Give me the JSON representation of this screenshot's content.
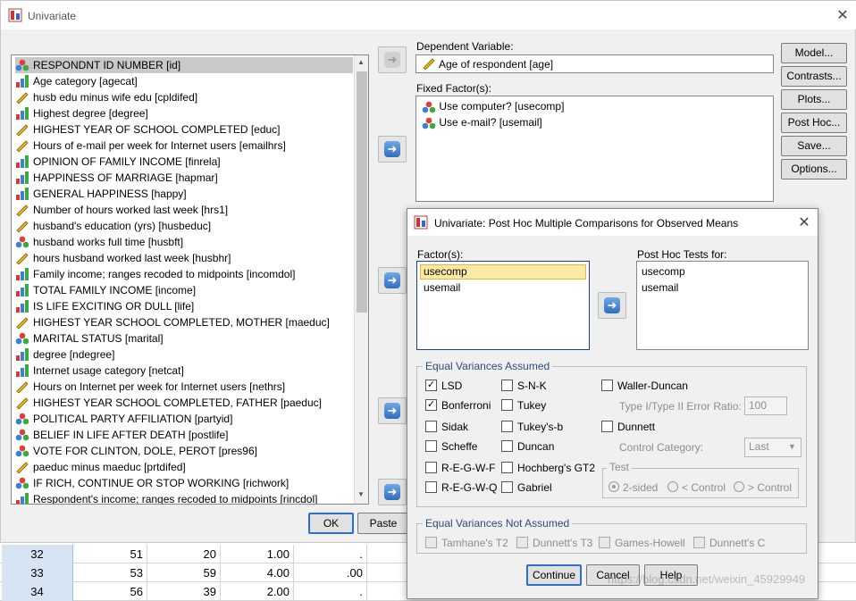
{
  "main_dialog": {
    "title": "Univariate",
    "variables": [
      {
        "label": "RESPONDNT ID NUMBER [id]",
        "icon": "nominal-icon"
      },
      {
        "label": "Age category [agecat]",
        "icon": "ordinal-icon"
      },
      {
        "label": "husb edu minus wife edu [cpldifed]",
        "icon": "scale-icon"
      },
      {
        "label": "Highest degree [degree]",
        "icon": "ordinal-icon"
      },
      {
        "label": "HIGHEST YEAR OF SCHOOL COMPLETED [educ]",
        "icon": "scale-icon"
      },
      {
        "label": "Hours of e-mail per week for Internet users [emailhrs]",
        "icon": "scale-icon"
      },
      {
        "label": "OPINION OF FAMILY INCOME [finrela]",
        "icon": "ordinal-icon"
      },
      {
        "label": "HAPPINESS OF MARRIAGE [hapmar]",
        "icon": "ordinal-icon"
      },
      {
        "label": "GENERAL HAPPINESS [happy]",
        "icon": "ordinal-icon"
      },
      {
        "label": "Number of hours worked last week [hrs1]",
        "icon": "scale-icon"
      },
      {
        "label": "husband's education (yrs) [husbeduc]",
        "icon": "scale-icon"
      },
      {
        "label": "husband works full time [husbft]",
        "icon": "nominal-icon"
      },
      {
        "label": "hours husband worked last week [husbhr]",
        "icon": "scale-icon"
      },
      {
        "label": "Family income; ranges recoded to midpoints [incomdol]",
        "icon": "ordinal-icon"
      },
      {
        "label": "TOTAL FAMILY INCOME [income]",
        "icon": "ordinal-icon"
      },
      {
        "label": "IS LIFE EXCITING OR DULL [life]",
        "icon": "ordinal-icon"
      },
      {
        "label": "HIGHEST YEAR SCHOOL COMPLETED, MOTHER [maeduc]",
        "icon": "scale-icon"
      },
      {
        "label": "MARITAL STATUS [marital]",
        "icon": "nominal-icon"
      },
      {
        "label": "degree [ndegree]",
        "icon": "ordinal-icon"
      },
      {
        "label": "Internet usage category [netcat]",
        "icon": "ordinal-icon"
      },
      {
        "label": "Hours on Internet per week for Internet users [nethrs]",
        "icon": "scale-icon"
      },
      {
        "label": "HIGHEST YEAR SCHOOL COMPLETED, FATHER [paeduc]",
        "icon": "scale-icon"
      },
      {
        "label": "POLITICAL PARTY AFFILIATION [partyid]",
        "icon": "nominal-icon"
      },
      {
        "label": "BELIEF IN LIFE AFTER DEATH [postlife]",
        "icon": "nominal-icon"
      },
      {
        "label": "VOTE FOR CLINTON, DOLE, PEROT [pres96]",
        "icon": "nominal-icon"
      },
      {
        "label": "paeduc minus maeduc [prtdifed]",
        "icon": "scale-icon"
      },
      {
        "label": "IF RICH, CONTINUE OR STOP WORKING [richwork]",
        "icon": "nominal-icon"
      },
      {
        "label": "Respondent's income; ranges recoded to midpoints [rincdol]",
        "icon": "ordinal-icon"
      }
    ],
    "dependent_label": "Dependent Variable:",
    "dependent_value": "Age of respondent [age]",
    "fixed_label": "Fixed Factor(s):",
    "fixed_factors": [
      "Use computer? [usecomp]",
      "Use e-mail? [usemail]"
    ],
    "side_buttons": {
      "model": "Model...",
      "contrasts": "Contrasts...",
      "plots": "Plots...",
      "posthoc": "Post Hoc...",
      "save": "Save...",
      "options": "Options..."
    },
    "ok": "OK",
    "paste": "Paste"
  },
  "posthoc_dialog": {
    "title": "Univariate: Post Hoc Multiple Comparisons for Observed Means",
    "factors_label": "Factor(s):",
    "factors": [
      "usecomp",
      "usemail"
    ],
    "tests_label": "Post Hoc Tests for:",
    "tests_for": [
      "usecomp",
      "usemail"
    ],
    "equal_assumed": "Equal Variances Assumed",
    "lsd": "LSD",
    "bonferroni": "Bonferroni",
    "sidak": "Sidak",
    "scheffe": "Scheffe",
    "regwf": "R-E-G-W-F",
    "regwq": "R-E-G-W-Q",
    "snk": "S-N-K",
    "tukey": "Tukey",
    "tukeyb": "Tukey's-b",
    "duncan": "Duncan",
    "hochberg": "Hochberg's GT2",
    "gabriel": "Gabriel",
    "waller": "Waller-Duncan",
    "error_ratio_label": "Type I/Type II Error Ratio:",
    "error_ratio_value": "100",
    "dunnett": "Dunnett",
    "control_label": "Control Category:",
    "control_value": "Last",
    "test_label": "Test",
    "two_sided": "2-sided",
    "lt_control": "< Control",
    "gt_control": "> Control",
    "not_assumed": "Equal Variances Not Assumed",
    "tamhane": "Tamhane's T2",
    "dunnett_t3": "Dunnett's T3",
    "games": "Games-Howell",
    "dunnett_c": "Dunnett's C",
    "continue": "Continue",
    "cancel": "Cancel",
    "help": "Help",
    "checked": [
      "LSD",
      "Bonferroni"
    ]
  },
  "data_grid": {
    "rows": [
      {
        "n": "32",
        "c1": "51",
        "c2": "20",
        "c3": "1.00",
        "c4": "."
      },
      {
        "n": "33",
        "c1": "53",
        "c2": "59",
        "c3": "4.00",
        "c4": ".00"
      },
      {
        "n": "34",
        "c1": "56",
        "c2": "39",
        "c3": "2.00",
        "c4": "."
      }
    ]
  },
  "watermark": "https://blog.csdn.net/weixin_45929949"
}
